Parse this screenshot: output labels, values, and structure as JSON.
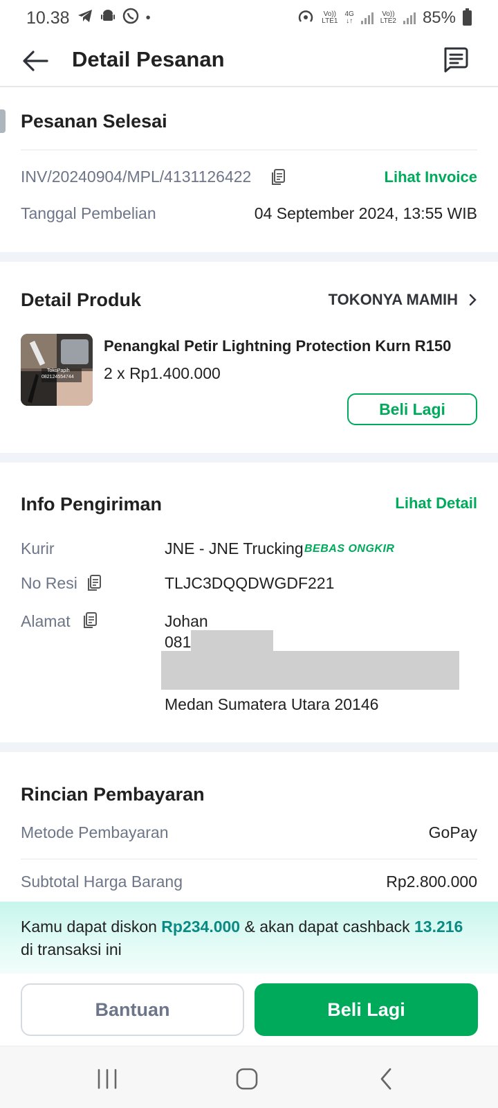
{
  "status_bar": {
    "time": "10.38",
    "net1_top": "Vo))",
    "net1_bottom": "LTE1",
    "net_4g": "4G",
    "net2_top": "Vo))",
    "net2_bottom": "LTE2",
    "battery": "85%"
  },
  "header": {
    "title": "Detail Pesanan"
  },
  "order_status": {
    "title": "Pesanan Selesai",
    "invoice_no": "INV/20240904/MPL/4131126422",
    "invoice_link": "Lihat Invoice",
    "date_label": "Tanggal Pembelian",
    "date_value": "04 September 2024, 13:55 WIB"
  },
  "product": {
    "section_title": "Detail Produk",
    "shop_name": "TOKONYA MAMIH",
    "name": "Penangkal Petir Lightning Protection Kurn R150",
    "qty_price": "2 x Rp1.400.000",
    "buy_again": "Beli Lagi",
    "image_caption_1": "TokoPapih",
    "image_caption_2": "082124554744"
  },
  "shipping": {
    "section_title": "Info Pengiriman",
    "detail_link": "Lihat Detail",
    "courier_label": "Kurir",
    "courier_value": "JNE - JNE Trucking",
    "free_shipping_badge": "BEBAS ONGKIR",
    "resi_label": "No Resi",
    "resi_value": "TLJC3DQQDWGDF221",
    "address_label": "Alamat",
    "address_name": "Johan",
    "address_phone": "081",
    "address_city": "Medan Sumatera Utara 20146"
  },
  "payment": {
    "section_title": "Rincian Pembayaran",
    "method_label": "Metode Pembayaran",
    "method_value": "GoPay",
    "subtotal_label": "Subtotal Harga Barang",
    "subtotal_value": "Rp2.800.000"
  },
  "banner": {
    "text_1": "Kamu dapat diskon ",
    "discount": "Rp234.000",
    "text_2": " & akan dapat cashback ",
    "cashback": "13.216",
    "text_3": " di transaksi ini"
  },
  "actions": {
    "help": "Bantuan",
    "buy_again": "Beli Lagi"
  }
}
